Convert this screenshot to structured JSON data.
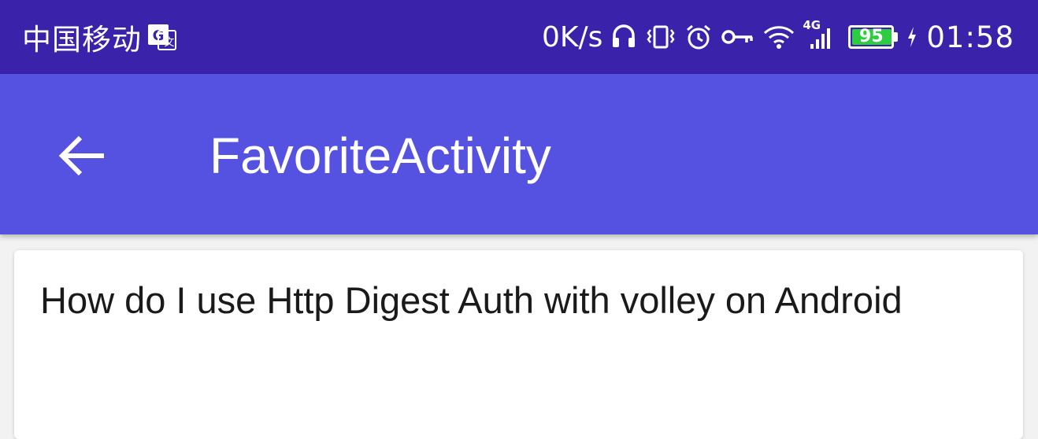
{
  "status_bar": {
    "carrier": "中国移动",
    "net_speed": "0K/s",
    "network_type": "4G",
    "battery_level": "95",
    "time": "01:58",
    "background_color": "#3a22aa",
    "battery_color": "#2ecc40",
    "icons": [
      "translate-icon",
      "headphones-icon",
      "vibrate-icon",
      "alarm-icon",
      "vpn-key-icon",
      "wifi-icon",
      "signal-icon",
      "battery-icon",
      "charging-icon"
    ]
  },
  "app_bar": {
    "title": "FavoriteActivity",
    "background_color": "#5552e2",
    "back_icon": "arrow-back-icon"
  },
  "favorites": [
    {
      "title": "How do I use Http Digest Auth with volley on Android"
    }
  ]
}
